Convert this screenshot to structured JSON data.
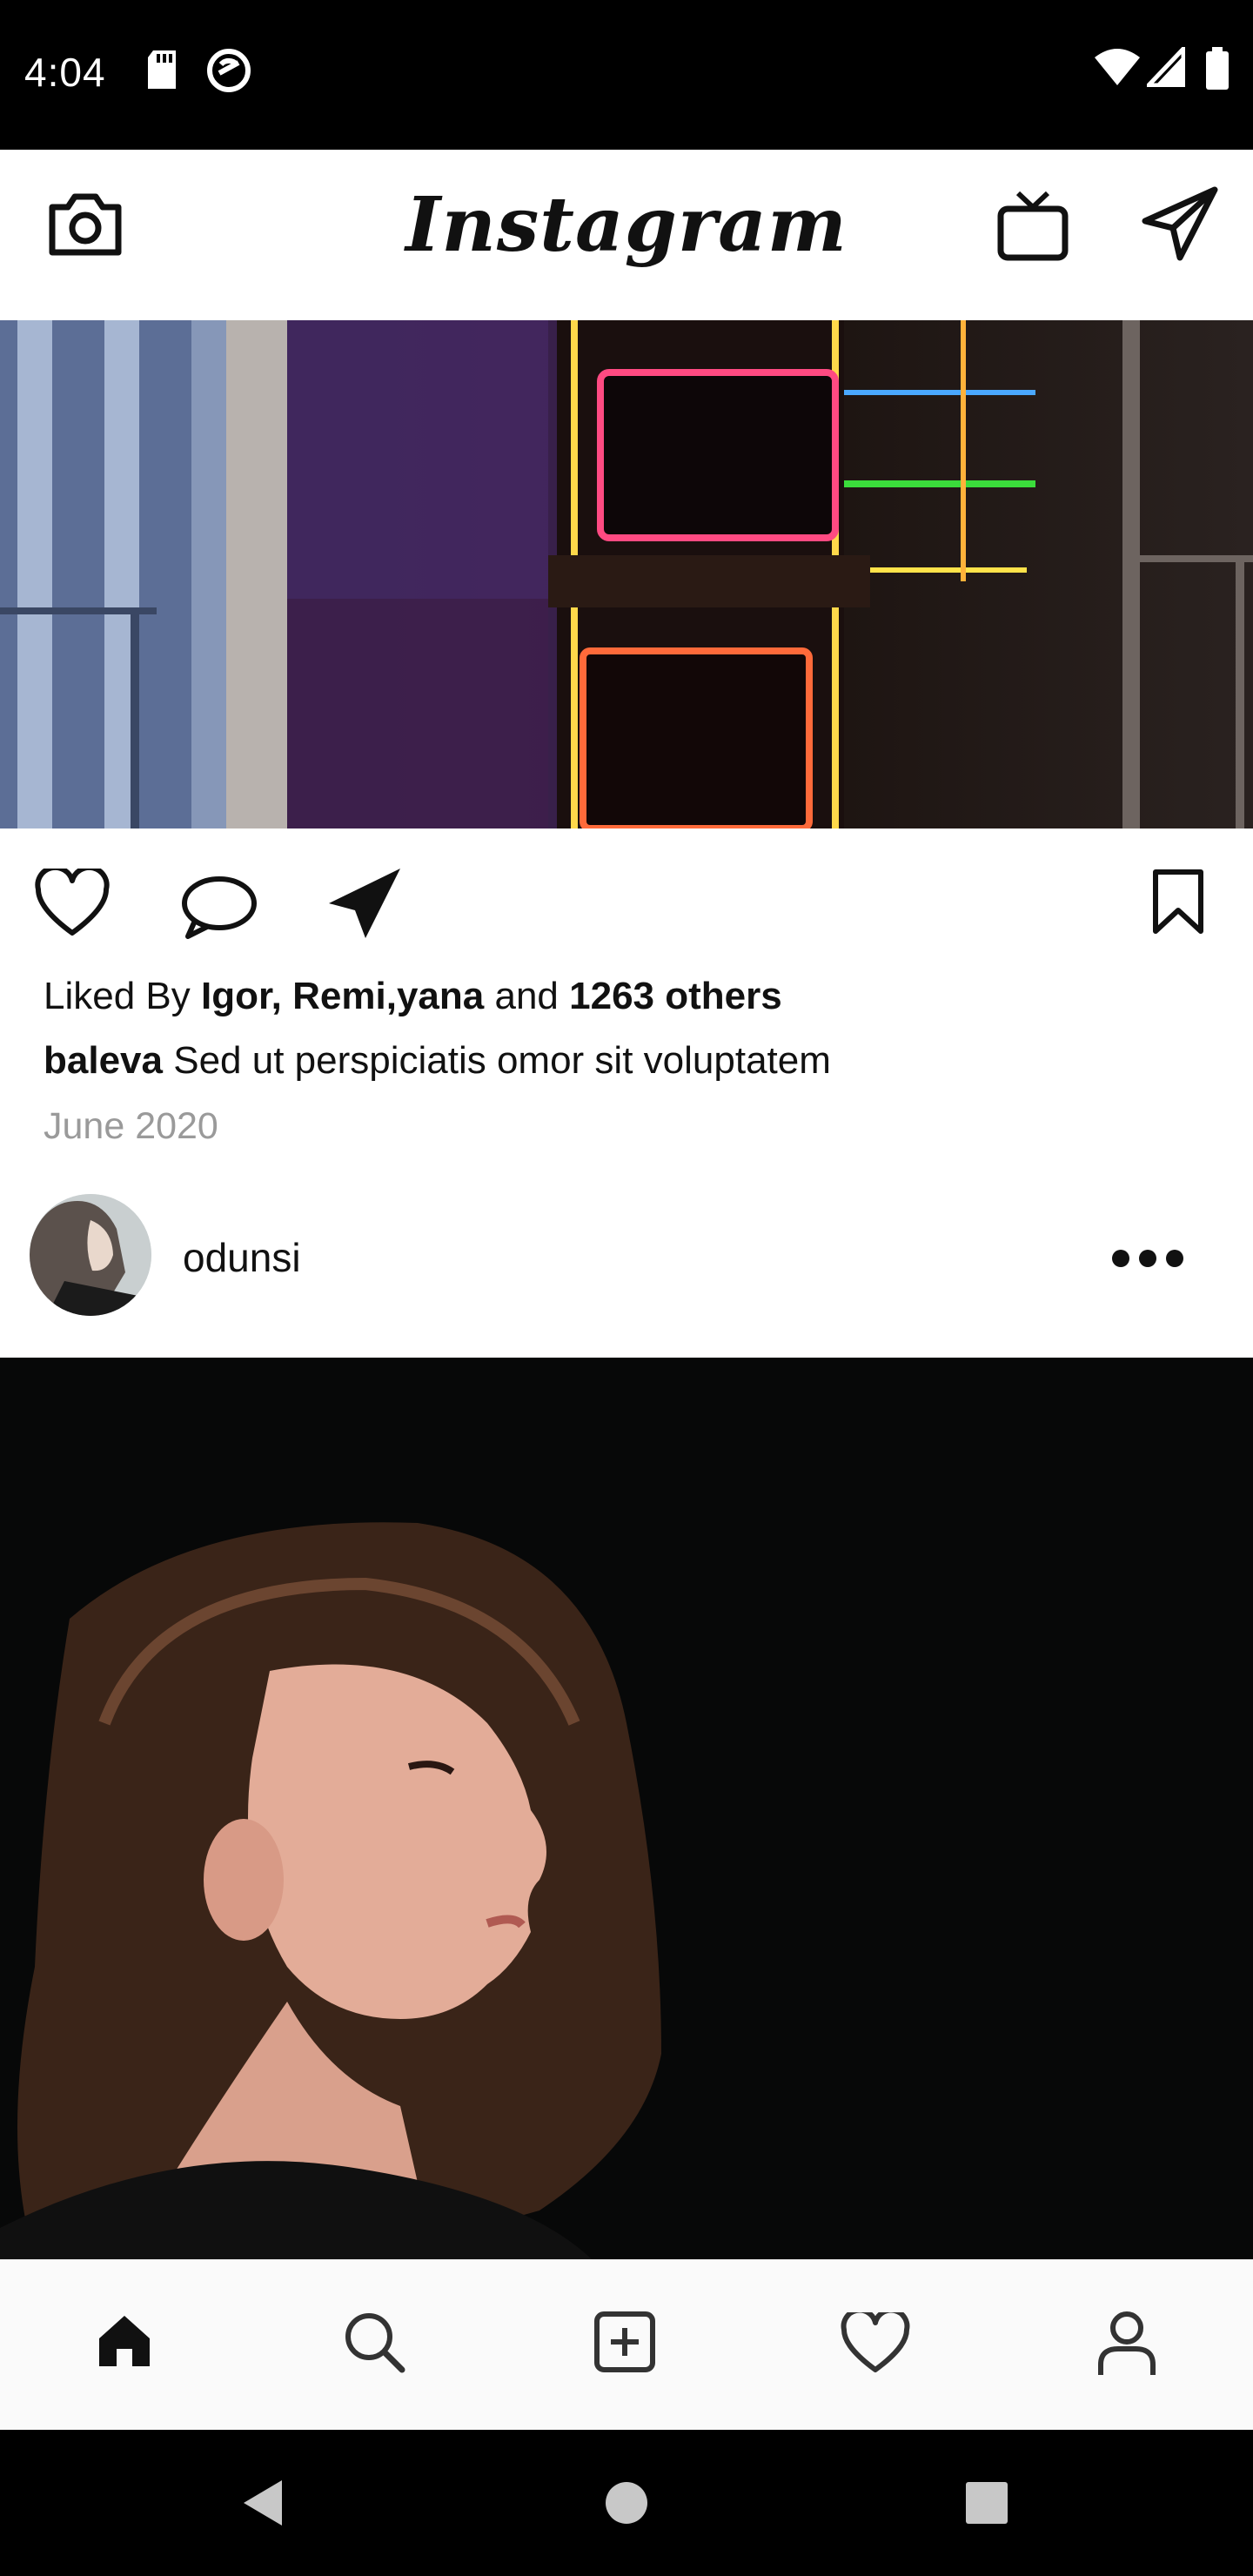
{
  "status_bar": {
    "time": "4:04",
    "icons": [
      "sd-card-icon",
      "do-not-disturb-icon",
      "wifi-icon",
      "cell-signal-icon",
      "battery-icon"
    ]
  },
  "header": {
    "brand": "Instagram",
    "icons": [
      "camera-icon",
      "igtv-icon",
      "direct-message-icon"
    ]
  },
  "post1": {
    "image": "arcade-neon-photo",
    "actions": [
      "like-icon",
      "comment-icon",
      "share-icon",
      "bookmark-icon"
    ],
    "likes_prefix": "Liked By",
    "likes_names": "Igor, Remi,yana",
    "likes_and": "and",
    "likes_others": "1263 others",
    "caption_user": "baleva",
    "caption_text": "Sed ut perspiciatis omor sit voluptatem",
    "date": "June 2020"
  },
  "post2": {
    "username": "odunsi",
    "more": "more-options-icon",
    "image": "woman-profile-photo"
  },
  "bottom_nav": {
    "items": [
      "home-icon",
      "search-icon",
      "add-post-icon",
      "activity-heart-icon",
      "profile-icon"
    ]
  },
  "system_nav": {
    "items": [
      "back-icon",
      "home-circle-icon",
      "recents-icon"
    ]
  }
}
